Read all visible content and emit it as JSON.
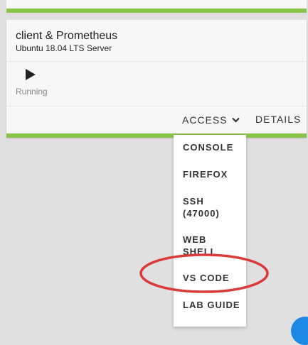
{
  "vm": {
    "title": "client & Prometheus",
    "subtitle": "Ubuntu 18.04 LTS Server",
    "status": "Running"
  },
  "actions": {
    "access_label": "ACCESS",
    "details_label": "DETAILS"
  },
  "access_menu": {
    "items": [
      {
        "label": "CONSOLE"
      },
      {
        "label": "FIREFOX"
      },
      {
        "label": "SSH (47000)"
      },
      {
        "label": "WEB SHELL"
      },
      {
        "label": "VS CODE"
      },
      {
        "label": "LAB GUIDE"
      }
    ]
  },
  "colors": {
    "accent_green": "#8bc34a",
    "annotation_red": "#d93a3a",
    "fab_blue": "#1e88e5"
  },
  "icons": {
    "play": "play-icon",
    "access_chevron": "chevron-down-icon"
  }
}
